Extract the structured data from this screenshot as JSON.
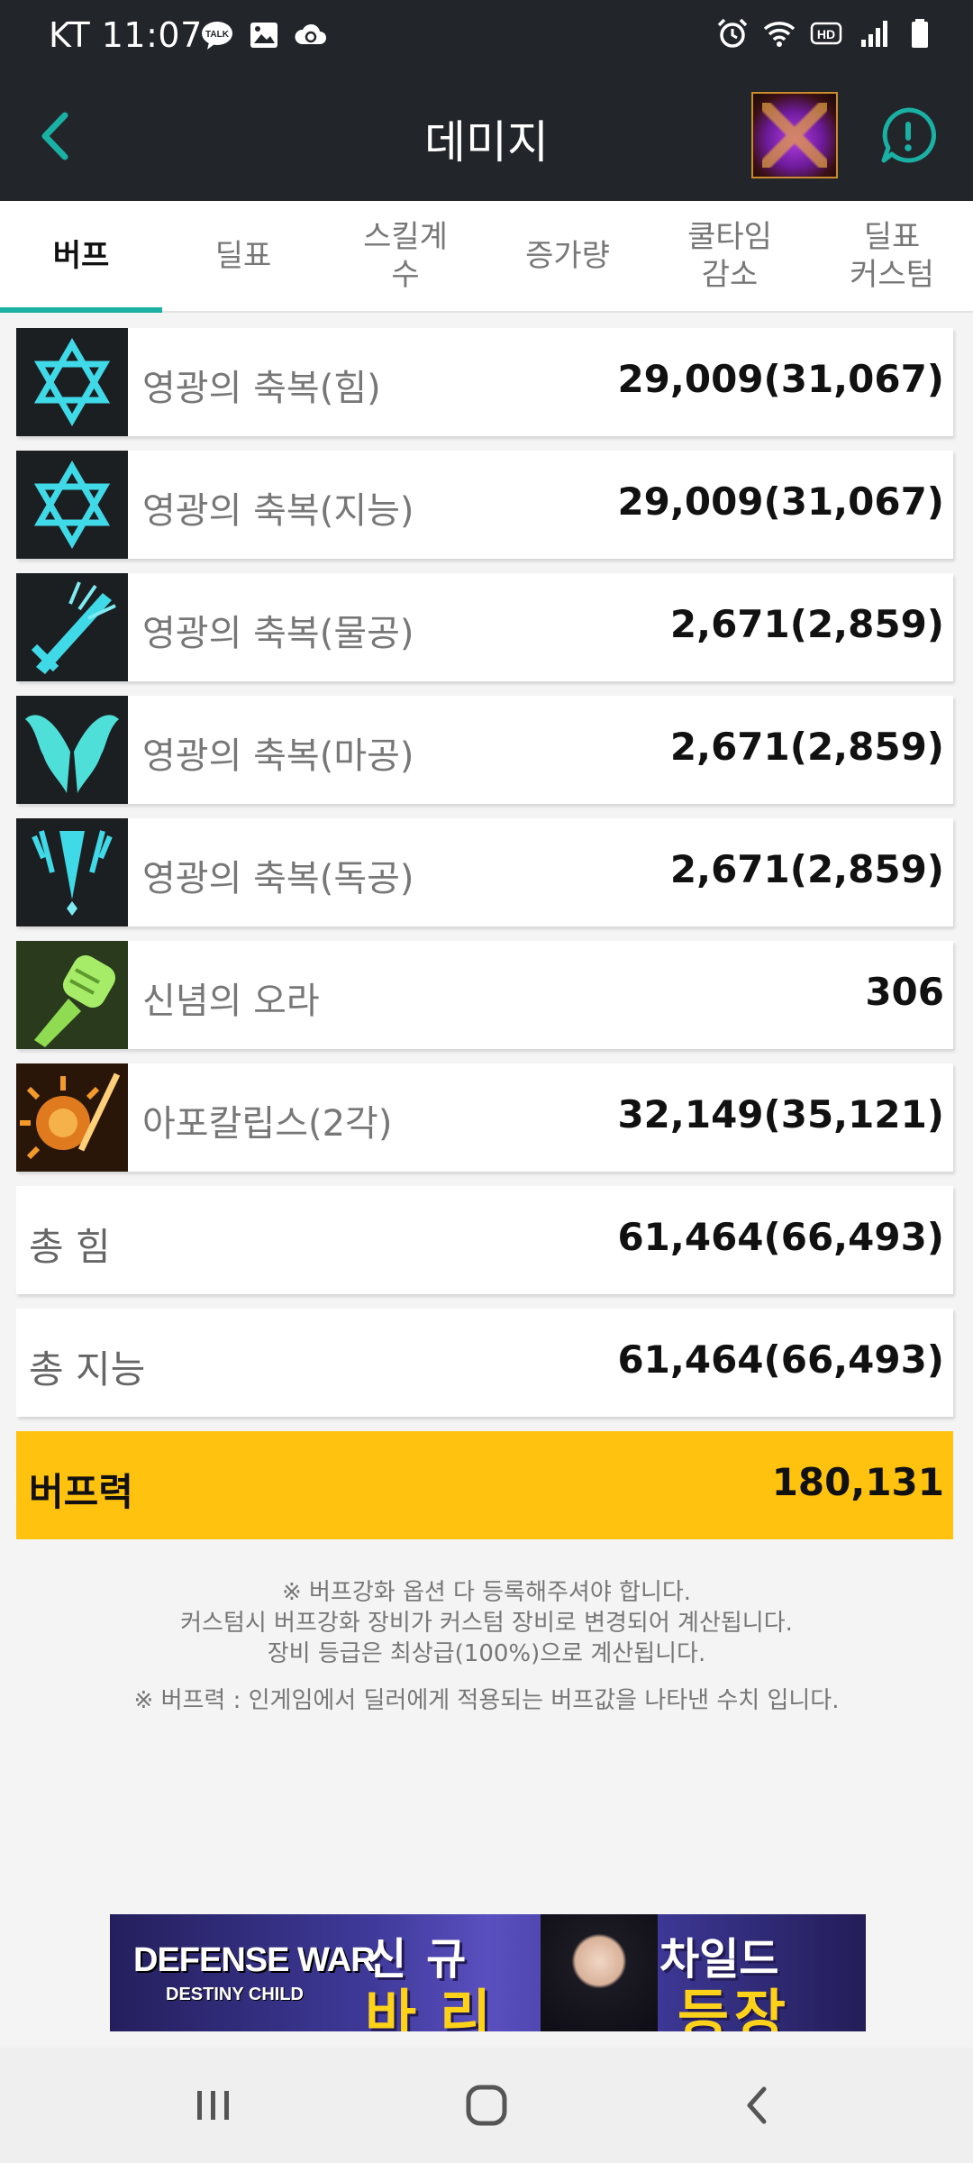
{
  "status_bar": {
    "carrier_time": "KT 11:07"
  },
  "app_bar": {
    "title": "데미지"
  },
  "tabs": [
    {
      "label": "버프",
      "active": true
    },
    {
      "label": "딜표",
      "active": false
    },
    {
      "label": "스킬계\n수",
      "active": false
    },
    {
      "label": "증가량",
      "active": false
    },
    {
      "label": "쿨타임\n감소",
      "active": false
    },
    {
      "label": "딜표\n커스텀",
      "active": false
    }
  ],
  "buffs": [
    {
      "icon": "hexagram-icon",
      "label": "영광의 축복(힘)",
      "value": "29,009(31,067)"
    },
    {
      "icon": "hexagram-icon",
      "label": "영광의 축복(지능)",
      "value": "29,009(31,067)"
    },
    {
      "icon": "sword-icon",
      "label": "영광의 축복(물공)",
      "value": "2,671(2,859)"
    },
    {
      "icon": "wings-icon",
      "label": "영광의 축복(마공)",
      "value": "2,671(2,859)"
    },
    {
      "icon": "blade-icon",
      "label": "영광의 축복(독공)",
      "value": "2,671(2,859)"
    },
    {
      "icon": "fist-icon",
      "label": "신념의 오라",
      "value": "306"
    },
    {
      "icon": "apocalypse-icon",
      "label": "아포칼립스(2각)",
      "value": "32,149(35,121)"
    }
  ],
  "totals": [
    {
      "label": "총 힘",
      "value": "61,464(66,493)"
    },
    {
      "label": "총 지능",
      "value": "61,464(66,493)"
    }
  ],
  "buff_power": {
    "label": "버프력",
    "value": "180,131"
  },
  "notes": {
    "line1": "※ 버프강화 옵션 다 등록해주셔야 합니다.",
    "line2": "커스텀시 버프강화 장비가 커스텀 장비로 변경되어 계산됩니다.",
    "line3": "장비 등급은 최상급(100%)으로 계산됩니다.",
    "line4": "※ 버프력 : 인게임에서 딜러에게 적용되는 버프값을 나타낸 수치 입니다."
  },
  "banner": {
    "brand": "DEFENSE WAR",
    "brand_sub": "DESTINY CHILD",
    "headline1": "신규",
    "headline2": "바리",
    "headline3": "차일드",
    "headline4": "등장"
  },
  "colors": {
    "accent": "#1ab0a4",
    "app_bar_bg": "#22252a",
    "buff_power_bg": "#ffc20e"
  }
}
